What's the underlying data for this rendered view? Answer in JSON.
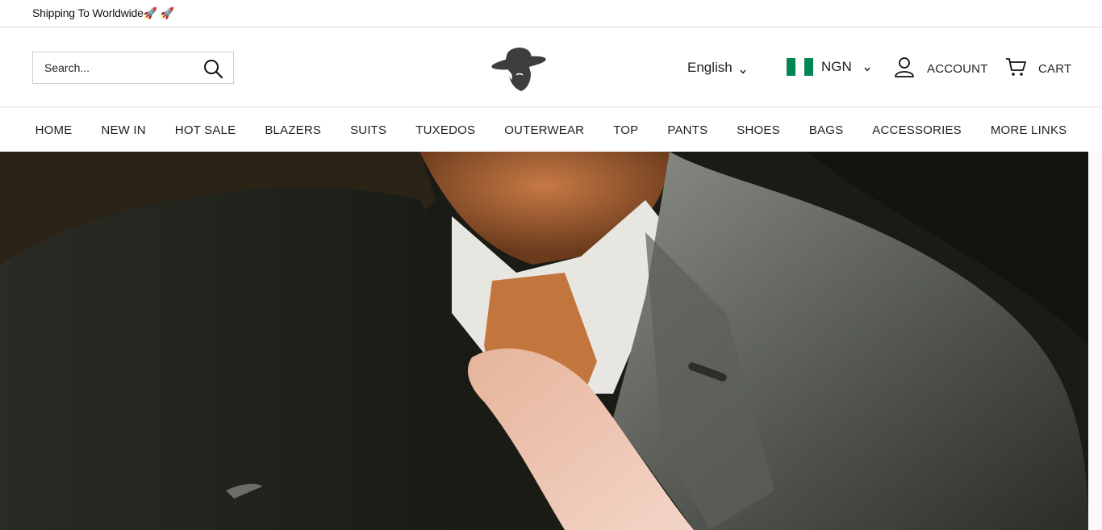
{
  "announcement": {
    "text": "Shipping To Worldwide🚀 🚀"
  },
  "header": {
    "search": {
      "placeholder": "Search..."
    },
    "language": {
      "label": "English"
    },
    "currency": {
      "code": "NGN",
      "flag_colors": [
        "#008751",
        "#ffffff",
        "#008751"
      ]
    },
    "account_label": "ACCOUNT",
    "cart_label": "CART"
  },
  "nav": {
    "items": [
      {
        "label": "HOME"
      },
      {
        "label": "NEW IN"
      },
      {
        "label": "HOT SALE"
      },
      {
        "label": "BLAZERS"
      },
      {
        "label": "SUITS"
      },
      {
        "label": "TUXEDOS"
      },
      {
        "label": "OUTERWEAR"
      },
      {
        "label": "TOP"
      },
      {
        "label": "PANTS"
      },
      {
        "label": "SHOES"
      },
      {
        "label": "BAGS"
      },
      {
        "label": "ACCESSORIES"
      },
      {
        "label": "MORE LINKS"
      }
    ]
  },
  "colors": {
    "text": "#222222",
    "border": "#dcdcdc",
    "logo": "#3d3d3d"
  }
}
